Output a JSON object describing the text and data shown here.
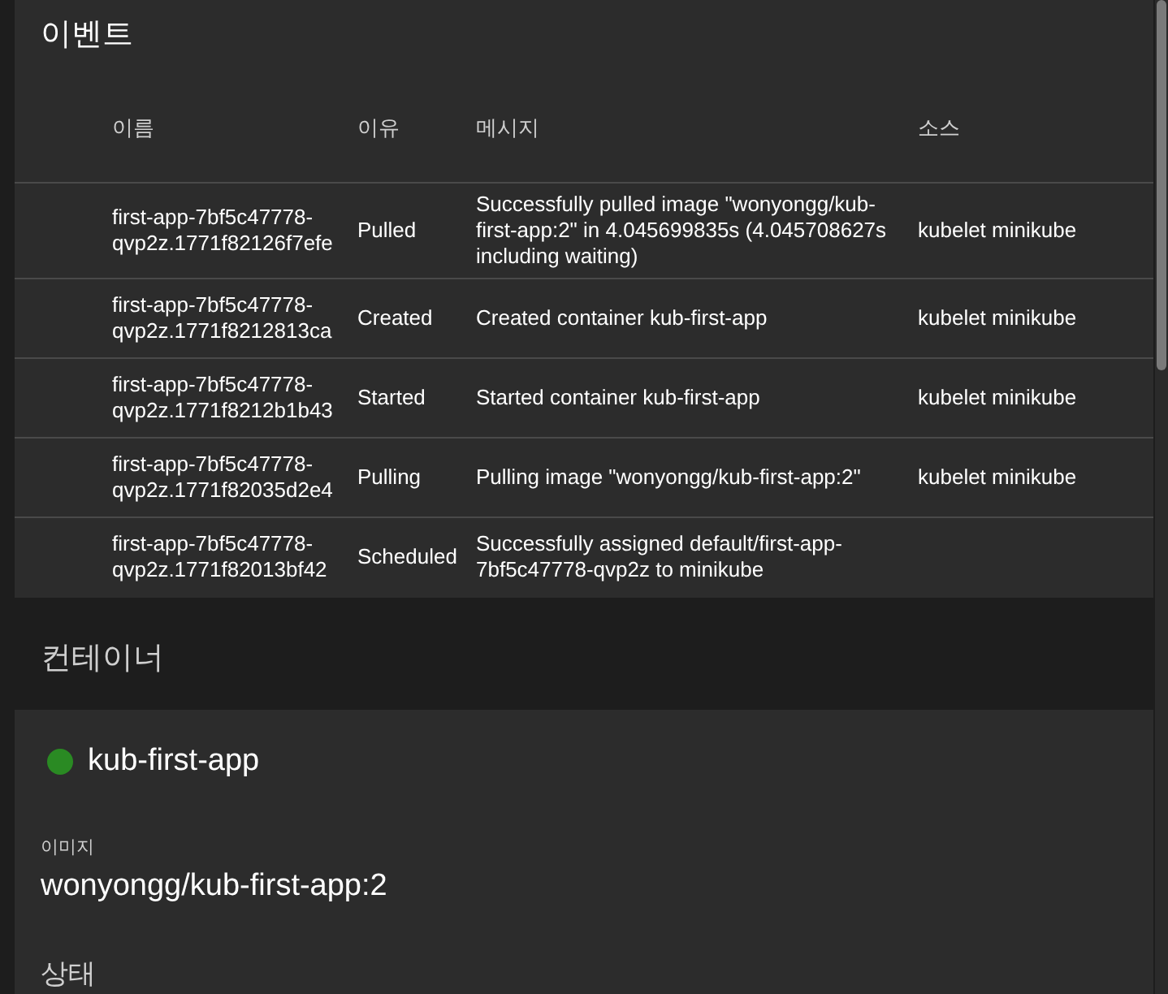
{
  "events": {
    "title": "이벤트",
    "columns": [
      "이름",
      "이유",
      "메시지",
      "소스"
    ],
    "rows": [
      {
        "name": "first-app-7bf5c47778-qvp2z.1771f82126f7efe",
        "reason": "Pulled",
        "message": "Successfully pulled image \"wonyongg/kub-first-app:2\" in 4.045699835s (4.045708627s including waiting)",
        "source": "kubelet minikube"
      },
      {
        "name": "first-app-7bf5c47778-qvp2z.1771f8212813ca",
        "reason": "Created",
        "message": "Created container kub-first-app",
        "source": "kubelet minikube"
      },
      {
        "name": "first-app-7bf5c47778-qvp2z.1771f8212b1b43",
        "reason": "Started",
        "message": "Started container kub-first-app",
        "source": "kubelet minikube"
      },
      {
        "name": "first-app-7bf5c47778-qvp2z.1771f82035d2e4",
        "reason": "Pulling",
        "message": "Pulling image \"wonyongg/kub-first-app:2\"",
        "source": "kubelet minikube"
      },
      {
        "name": "first-app-7bf5c47778-qvp2z.1771f82013bf42",
        "reason": "Scheduled",
        "message": "Successfully assigned default/first-app-7bf5c47778-qvp2z to minikube"
      }
    ]
  },
  "containers": {
    "title": "컨테이너",
    "items": [
      {
        "name": "kub-first-app",
        "color": "#2a8a23",
        "image_label": "이미지",
        "image": "wonyongg/kub-first-app:2",
        "status_label": "상태"
      }
    ]
  }
}
